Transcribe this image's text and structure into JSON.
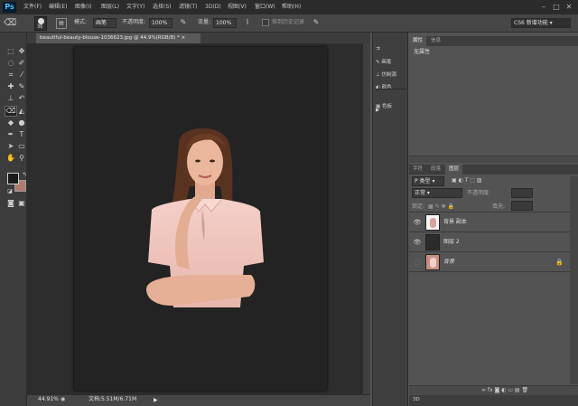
{
  "app": {
    "logo": "Ps"
  },
  "menu": [
    "文件(F)",
    "编辑(E)",
    "图像(I)",
    "图层(L)",
    "文字(Y)",
    "选择(S)",
    "滤镜(T)",
    "3D(D)",
    "视图(V)",
    "窗口(W)",
    "帮助(H)"
  ],
  "options": {
    "brush_size": "36",
    "mode_label": "模式:",
    "mode_value": "画笔",
    "opacity_label": "不透明度:",
    "opacity_value": "100%",
    "flow_label": "流量:",
    "flow_value": "100%",
    "history_label": "抹到历史记录",
    "workspace": "CS6 新增功能"
  },
  "document": {
    "tab_title": "beautiful-beauty-blouse-1036623.jpg @ 44.9%(RGB/8) *",
    "zoom": "44.91%",
    "doc_info": "文档:5.51M/6.71M"
  },
  "mid_panel": [
    "画笔",
    "仿制源",
    "颜色",
    "色板"
  ],
  "properties": {
    "tabs": [
      "属性",
      "信息"
    ],
    "content": "无属性"
  },
  "layers_panel": {
    "tabs": [
      "字符",
      "段落",
      "图层"
    ],
    "filter_label": "P 类型",
    "blend_mode": "正常",
    "opacity_label": "不透明度:",
    "lock_label": "锁定:",
    "fill_label": "填充:",
    "layers": [
      {
        "name": "背景 副本"
      },
      {
        "name": "图层 2"
      },
      {
        "name": "背景"
      }
    ]
  },
  "footer": {
    "left_tab": "3D"
  },
  "colors": {
    "foreground": "#1a1a1a",
    "background": "#b07c70"
  }
}
